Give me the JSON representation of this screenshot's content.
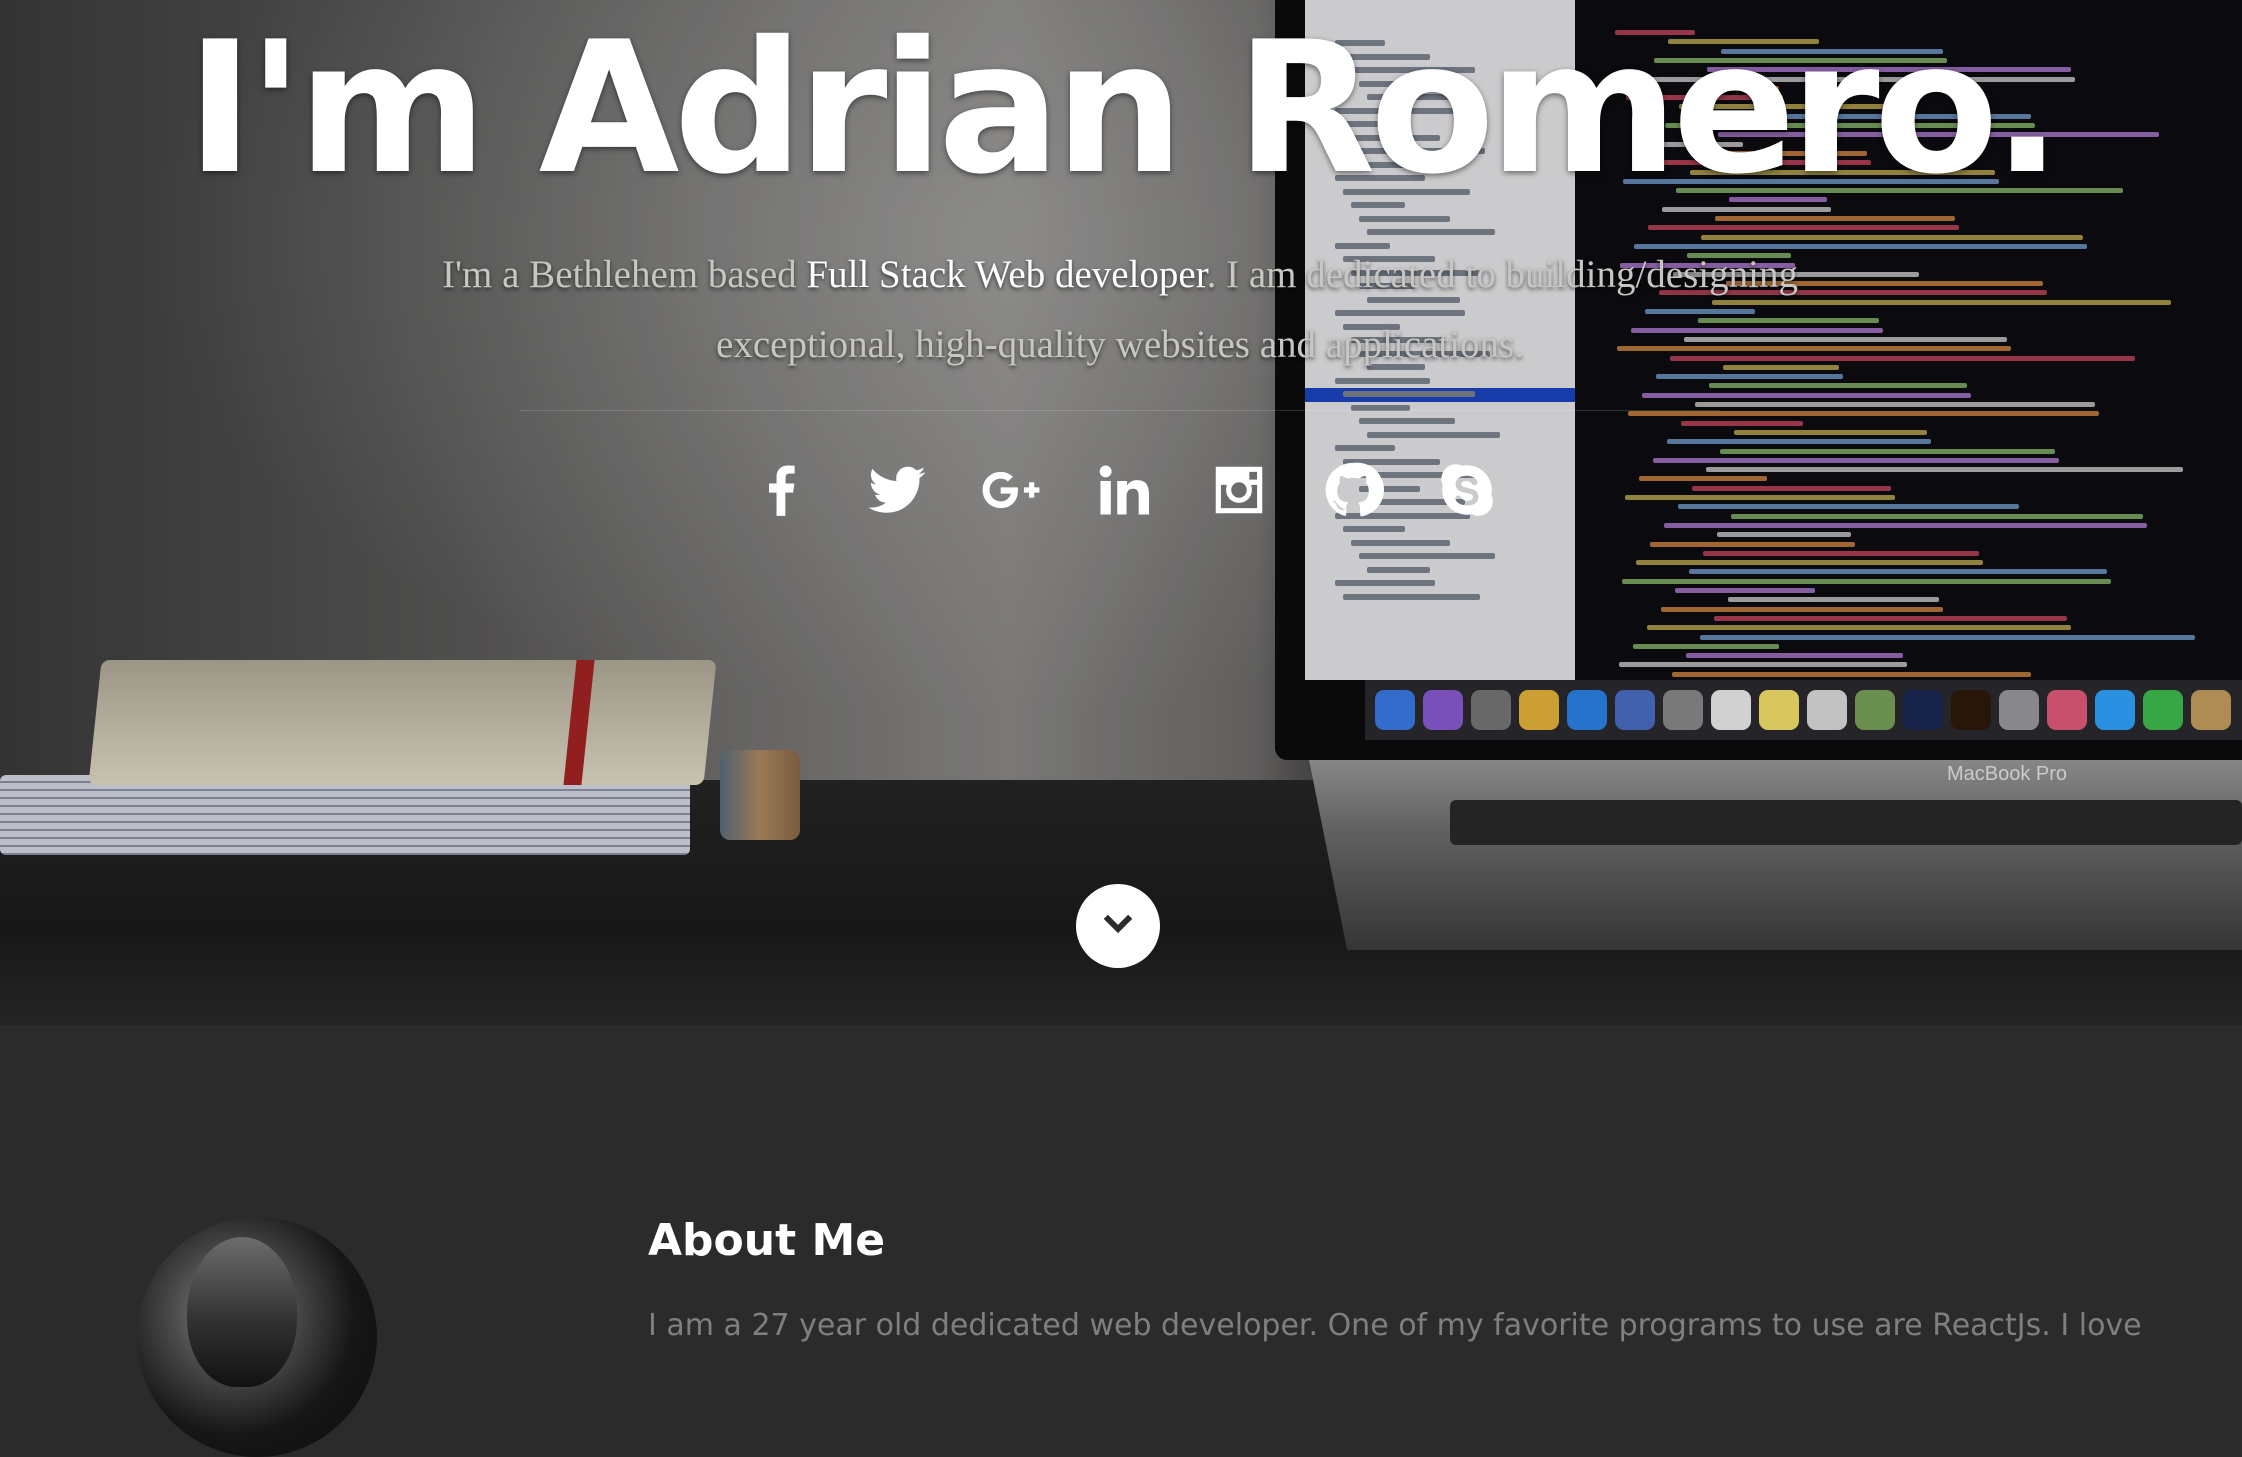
{
  "hero": {
    "title": "I'm Adrian Romero.",
    "tagline_prefix": "I'm a Bethlehem based ",
    "tagline_highlight": "Full Stack Web developer",
    "tagline_suffix": ". I am dedicated to building/designing exceptional, high-quality websites and applications.",
    "background_photo_text": "MacBook Pro"
  },
  "socials": [
    {
      "name": "facebook-icon"
    },
    {
      "name": "twitter-icon"
    },
    {
      "name": "google-plus-icon"
    },
    {
      "name": "linkedin-icon"
    },
    {
      "name": "instagram-icon"
    },
    {
      "name": "github-icon"
    },
    {
      "name": "skype-icon"
    }
  ],
  "scroll_down": {
    "icon": "chevron-down-icon"
  },
  "about": {
    "heading": "About Me",
    "text": "I am a 27 year old dedicated web developer. One of my favorite programs to use are ReactJs. I love"
  },
  "colors": {
    "hero_title": "#ffffff",
    "section_bg": "#2b2b2b",
    "about_text": "#7f7f7f"
  }
}
